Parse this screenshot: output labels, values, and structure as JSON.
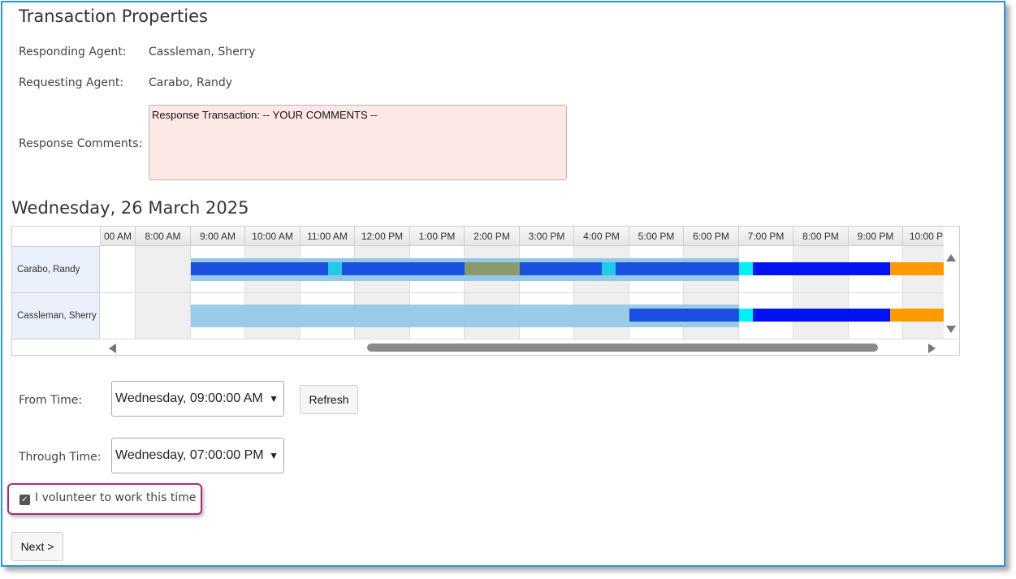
{
  "title": "Transaction Properties",
  "fields": {
    "responding_agent_label": "Responding Agent:",
    "responding_agent_value": "Cassleman, Sherry",
    "requesting_agent_label": "Requesting Agent:",
    "requesting_agent_value": "Carabo, Randy",
    "response_comments_label": "Response Comments:",
    "response_comments_value": "Response Transaction: -- YOUR COMMENTS --"
  },
  "schedule": {
    "date_heading": "Wednesday, 26 March 2025",
    "hours": [
      "00 AM",
      "8:00 AM",
      "9:00 AM",
      "10:00 AM",
      "11:00 AM",
      "12:00 PM",
      "1:00 PM",
      "2:00 PM",
      "3:00 PM",
      "4:00 PM",
      "5:00 PM",
      "6:00 PM",
      "7:00 PM",
      "8:00 PM",
      "9:00 PM",
      "10:00 PM"
    ],
    "resources": [
      "Carabo, Randy",
      "Cassleman, Sherry"
    ],
    "colors": {
      "available_light": "#93c9e6",
      "shift_blue": "#1a4fe0",
      "break_cyan": "#1ecbe8",
      "conflict_olive": "#8a9a6a",
      "overtime_blue": "#0013f0",
      "orange": "#ff9a00",
      "highlight_cyan": "#00f0f8"
    },
    "label_colors": {
      "window_border": "#2a95dc",
      "comments_bg": "#fde8e5",
      "highlight_border": "#b0267d"
    }
  },
  "controls": {
    "from_label": "From Time:",
    "from_value": "Wednesday, 09:00:00 AM",
    "through_label": "Through Time:",
    "through_value": "Wednesday, 07:00:00 PM",
    "refresh_label": "Refresh",
    "volunteer_label": "I volunteer to work this time",
    "volunteer_checked": true,
    "next_label": "Next >"
  }
}
